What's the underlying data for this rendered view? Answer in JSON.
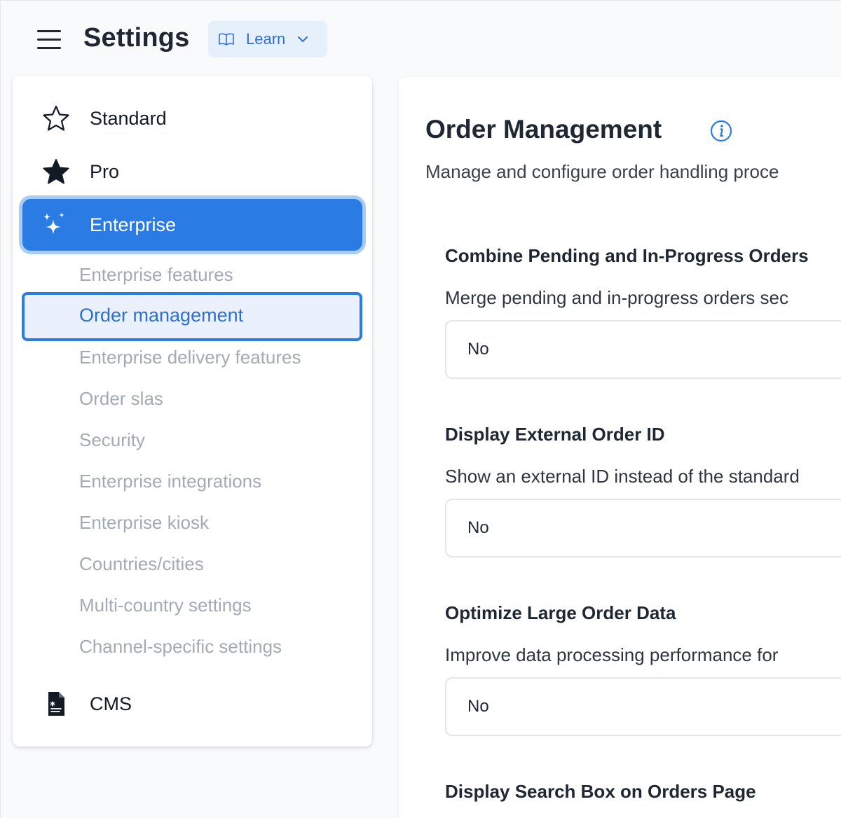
{
  "header": {
    "title": "Settings",
    "learn_label": "Learn"
  },
  "sidebar": {
    "plans": {
      "standard": "Standard",
      "pro": "Pro",
      "enterprise": "Enterprise",
      "cms": "CMS"
    },
    "sub_items": [
      "Enterprise features",
      "Order management",
      "Enterprise delivery features",
      "Order slas",
      "Security",
      "Enterprise integrations",
      "Enterprise kiosk",
      "Countries/cities",
      "Multi-country settings",
      "Channel-specific settings"
    ],
    "active_sub_index": 1
  },
  "content": {
    "title": "Order Management",
    "description": "Manage and configure order handling proce",
    "settings": [
      {
        "heading": "Combine Pending and In-Progress Orders",
        "description": "Merge pending and in-progress orders sec",
        "value": "No"
      },
      {
        "heading": "Display External Order ID",
        "description": "Show an external ID instead of the standard",
        "value": "No"
      },
      {
        "heading": "Optimize Large Order Data",
        "description": "Improve data processing performance for",
        "value": "No"
      },
      {
        "heading": "Display Search Box on Orders Page",
        "description": "",
        "value": ""
      }
    ]
  },
  "colors": {
    "accent": "#2b7be4",
    "accent_light": "#eaf1fc",
    "learn_bg": "#e6f0fb",
    "muted_text": "#a4aab3"
  },
  "icons": {
    "menu": "hamburger-icon",
    "learn": "book-icon",
    "learn_chevron": "chevron-down-icon",
    "standard": "star-outline-icon",
    "pro": "star-filled-icon",
    "enterprise": "sparkles-icon",
    "cms": "document-icon",
    "info": "info-icon"
  }
}
